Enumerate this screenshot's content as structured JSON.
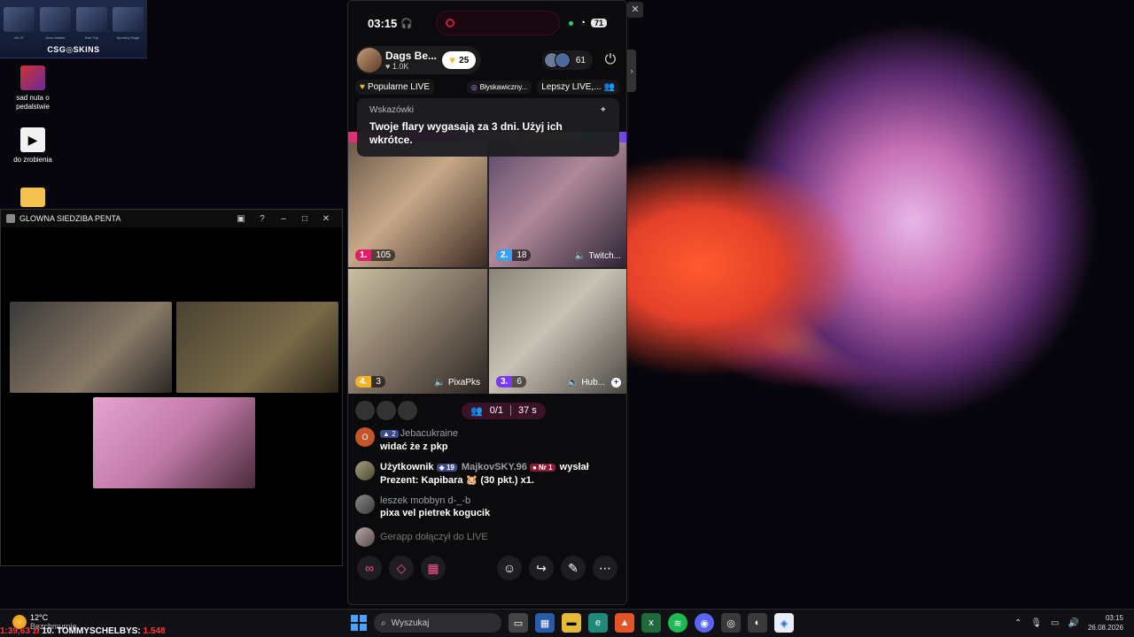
{
  "desktop": {
    "banner": {
      "brand": "CSG◎SKINS",
      "items": [
        "AK-47",
        "Sous Master",
        "Bad Trip",
        "Sporting Rage"
      ]
    },
    "icons": [
      {
        "label": "sad nuta o pedalstwie"
      },
      {
        "label": "do zrobienia"
      },
      {
        "label": ""
      }
    ]
  },
  "left_window": {
    "title": "GLOWNA SIEDZIBA PENTA"
  },
  "phone": {
    "status": {
      "time": "03:15",
      "battery": "71"
    },
    "host": {
      "name": "Dags Be...",
      "likes": "1.0K",
      "follow_count": "25",
      "viewers": "61"
    },
    "tags": [
      "Popularne LIVE",
      "Błyskawiczny...",
      "Lepszy LIVE,..."
    ],
    "hint": {
      "header": "Wskazówki",
      "message": "Twoje flary wygasają za 3 dni. Użyj ich wkrótce."
    },
    "tiles": [
      {
        "rank": "1.",
        "value": "105",
        "name": "",
        "rank_color": "#e01f6b"
      },
      {
        "rank": "2.",
        "value": "18",
        "name": "Twitch...",
        "rank_color": "#3aa0f0"
      },
      {
        "rank": "4.",
        "value": "3",
        "name": "PixaPks",
        "rank_color": "#f0b42a"
      },
      {
        "rank": "3.",
        "value": "6",
        "name": "Hub...",
        "rank_color": "#7a3af0"
      }
    ],
    "join": {
      "slots": "0/1",
      "time": "37 s"
    },
    "chat": [
      {
        "avatar": "O",
        "level": "2",
        "user": "Jebacukraine",
        "text": "widać że z pkp"
      },
      {
        "avatar": "",
        "user": "Użytkownik",
        "level": "19",
        "user2": "MajkovSKY.96",
        "badge": "Nr 1",
        "action": "wysłał",
        "text": "Prezent: Kapibara",
        "extra": "(30 pkt.) x1."
      },
      {
        "avatar": "",
        "user": "leszek mobbyn d-_-b",
        "text": "pixa vel pietrek kogucik"
      },
      {
        "avatar": "",
        "user": "",
        "text": "Gerapp dołączył do LIVE"
      }
    ]
  },
  "taskbar": {
    "temp": "12°C",
    "weather_label": "Bezchmurnie",
    "ticker_left": "1:39,63 zł",
    "ticker_name": "10. TOMMYSCHELBYS:",
    "ticker_value": "1.548",
    "search_placeholder": "Wyszukaj",
    "time": "03:15",
    "date": "26.08.2026"
  }
}
